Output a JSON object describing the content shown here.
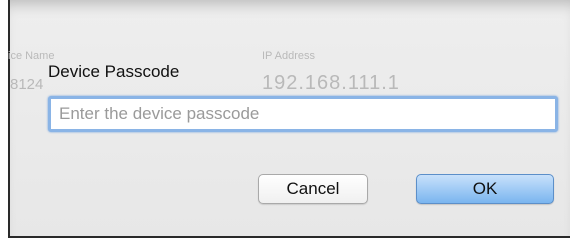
{
  "dialog": {
    "title": "Device Passcode",
    "passcode_input": {
      "value": "",
      "placeholder": "Enter the device passcode"
    },
    "cancel_label": "Cancel",
    "ok_label": "OK"
  },
  "background_table": {
    "col_device_name_header": "ice Name",
    "col_ip_address_header": "IP Address",
    "row_device_name": "8124",
    "row_ip_address": "192.168.111.1"
  }
}
